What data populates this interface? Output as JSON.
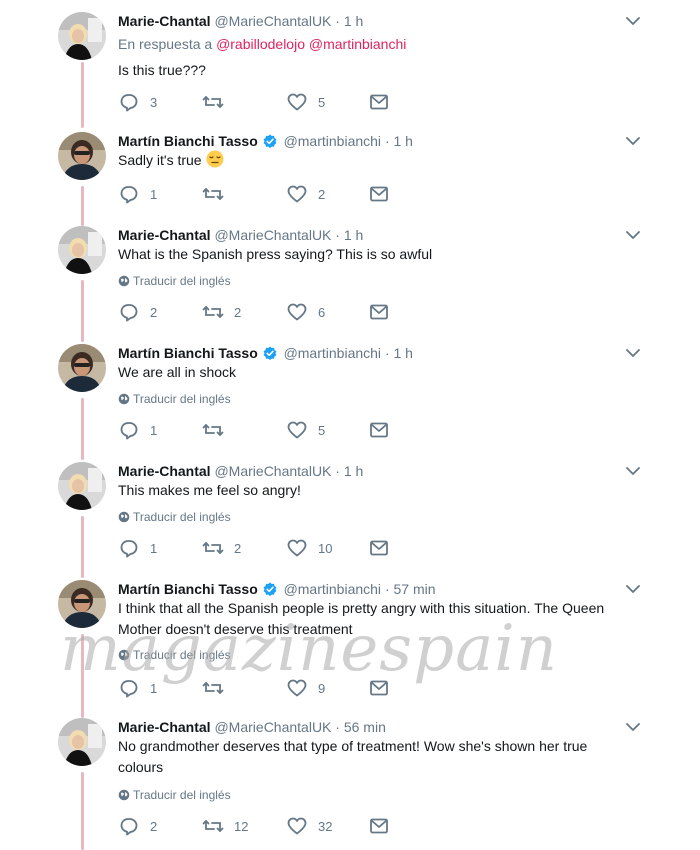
{
  "translate_label": "Traducir del inglés",
  "watermark": "magazinespain",
  "tweets": [
    {
      "name": "Marie-Chantal",
      "handle": "@MarieChantalUK",
      "time": "1 h",
      "reply_prefix": "En respuesta a",
      "reply_mention_1": "@rabillodelojo",
      "reply_mention_2": "@martinbianchi",
      "text": "Is this true???",
      "replies": "3",
      "retweets": "",
      "likes": "5"
    },
    {
      "name": "Martín Bianchi Tasso",
      "handle": "@martinbianchi",
      "time": "1 h",
      "text": "Sadly it's true",
      "replies": "1",
      "retweets": "",
      "likes": "2"
    },
    {
      "name": "Marie-Chantal",
      "handle": "@MarieChantalUK",
      "time": "1 h",
      "text": "What is the Spanish press saying? This is so awful",
      "replies": "2",
      "retweets": "2",
      "likes": "6"
    },
    {
      "name": "Martín Bianchi Tasso",
      "handle": "@martinbianchi",
      "time": "1 h",
      "text": "We are all in shock",
      "replies": "1",
      "retweets": "",
      "likes": "5"
    },
    {
      "name": "Marie-Chantal",
      "handle": "@MarieChantalUK",
      "time": "1 h",
      "text": "This makes me feel so angry!",
      "replies": "1",
      "retweets": "2",
      "likes": "10"
    },
    {
      "name": "Martín Bianchi Tasso",
      "handle": "@martinbianchi",
      "time": "57 min",
      "text": "I think that all the Spanish people is pretty angry with this situation. The Queen Mother doesn't deserve this treatment",
      "replies": "1",
      "retweets": "",
      "likes": "9"
    },
    {
      "name": "Marie-Chantal",
      "handle": "@MarieChantalUK",
      "time": "56 min",
      "text": "No grandmother deserves that type of treatment! Wow she's shown her true colours",
      "replies": "2",
      "retweets": "12",
      "likes": "32"
    }
  ]
}
